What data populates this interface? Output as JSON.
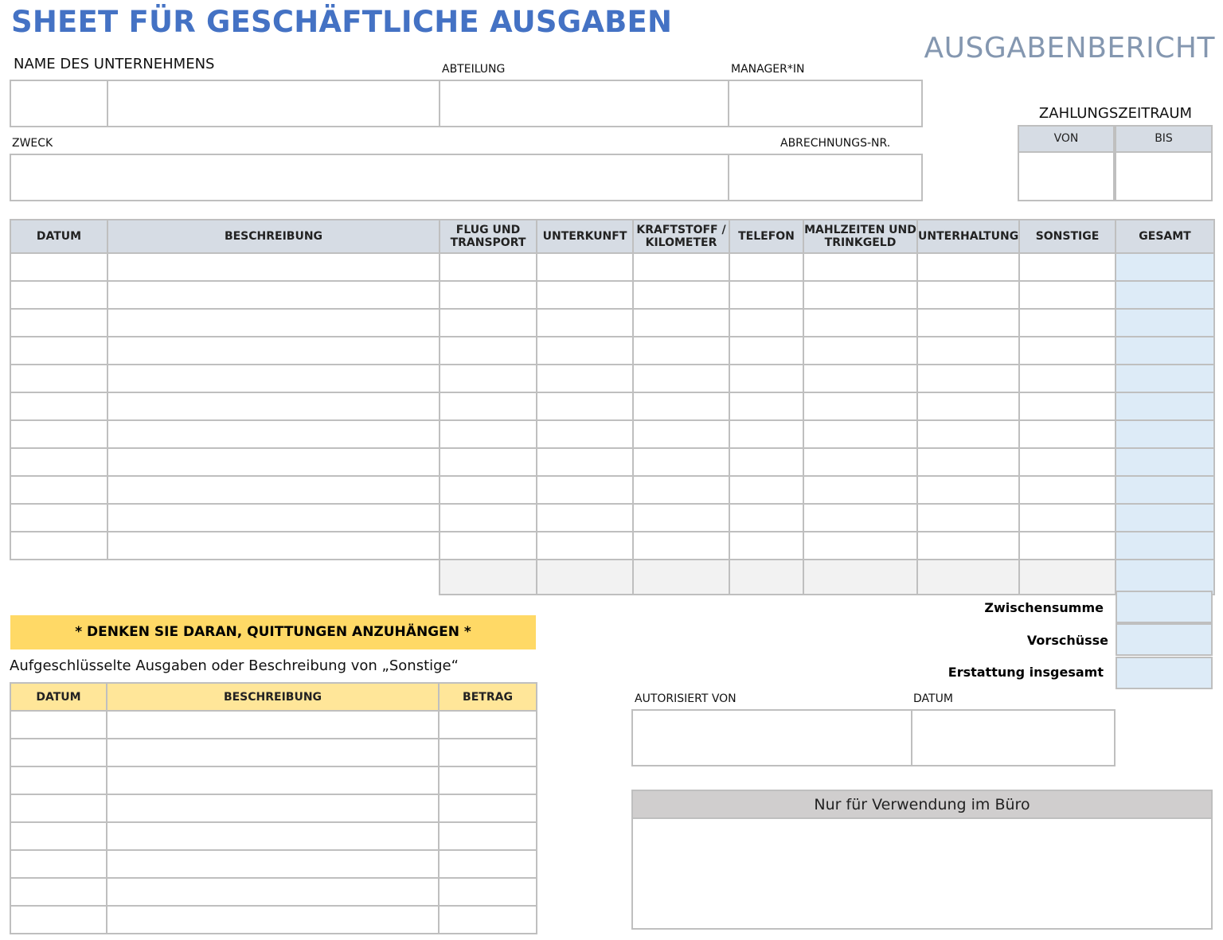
{
  "header": {
    "title": "SHEET FÜR GESCHÄFTLICHE AUSGABEN",
    "report_title": "AUSGABENBERICHT"
  },
  "info": {
    "company_label": "NAME DES UNTERNEHMENS",
    "department_label": "ABTEILUNG",
    "manager_label": "MANAGER*IN",
    "purpose_label": "ZWECK",
    "statement_no_label": "ABRECHNUNGS-NR."
  },
  "pay_period": {
    "label": "ZAHLUNGSZEITRAUM",
    "from_label": "VON",
    "to_label": "BIS"
  },
  "expense_table": {
    "columns": [
      "DATUM",
      "BESCHREIBUNG",
      "FLUG UND TRANSPORT",
      "UNTERKUNFT",
      "KRAFTSTOFF / KILOMETER",
      "TELEFON",
      "MAHLZEITEN UND TRINKGELD",
      "UNTERHALTUNG",
      "SONSTIGE",
      "GESAMT"
    ],
    "row_count": 11
  },
  "summary": {
    "subtotal_label": "Zwischensumme",
    "advances_label": "Vorschüsse",
    "reimbursement_label": "Erstattung insgesamt"
  },
  "reminder": "* DENKEN SIE DARAN, QUITTUNGEN ANZUHÄNGEN *",
  "itemized": {
    "label": "Aufgeschlüsselte Ausgaben oder Beschreibung von „Sonstige“",
    "columns": [
      "DATUM",
      "BESCHREIBUNG",
      "BETRAG"
    ],
    "row_count": 8
  },
  "authorization": {
    "authorized_by_label": "AUTORISIERT VON",
    "date_label": "DATUM"
  },
  "office": {
    "label": "Nur für Verwendung im Büro"
  }
}
